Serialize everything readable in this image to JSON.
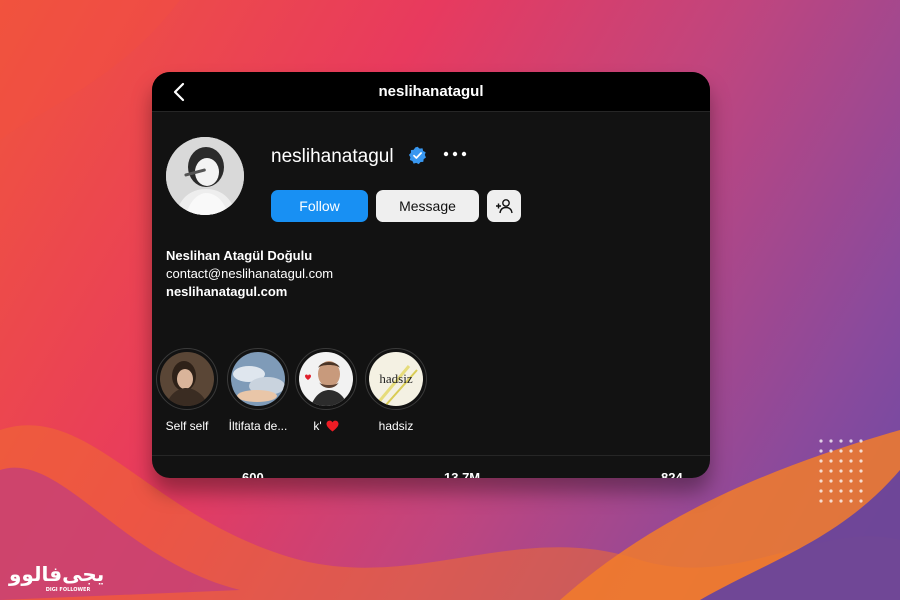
{
  "header": {
    "title": "neslihanatagul"
  },
  "profile": {
    "username": "neslihanatagul",
    "verified": true,
    "follow_label": "Follow",
    "message_label": "Message",
    "full_name": "Neslihan Atagül Doğulu",
    "email": "contact@neslihanatagul.com",
    "website": "neslihanatagul.com"
  },
  "highlights": [
    {
      "label": "Self self"
    },
    {
      "label": "İltifata de..."
    },
    {
      "label": "k'"
    },
    {
      "label": "hadsiz"
    }
  ],
  "stats": {
    "posts": "600",
    "followers": "13.7M",
    "following": "824"
  },
  "colors": {
    "accent": "#1890f3",
    "background": "#121212",
    "verified": "#3897f0"
  },
  "icons": [
    "chevron-left-icon",
    "verified-badge-icon",
    "more-horizontal-icon",
    "add-user-icon",
    "heart-icon"
  ]
}
